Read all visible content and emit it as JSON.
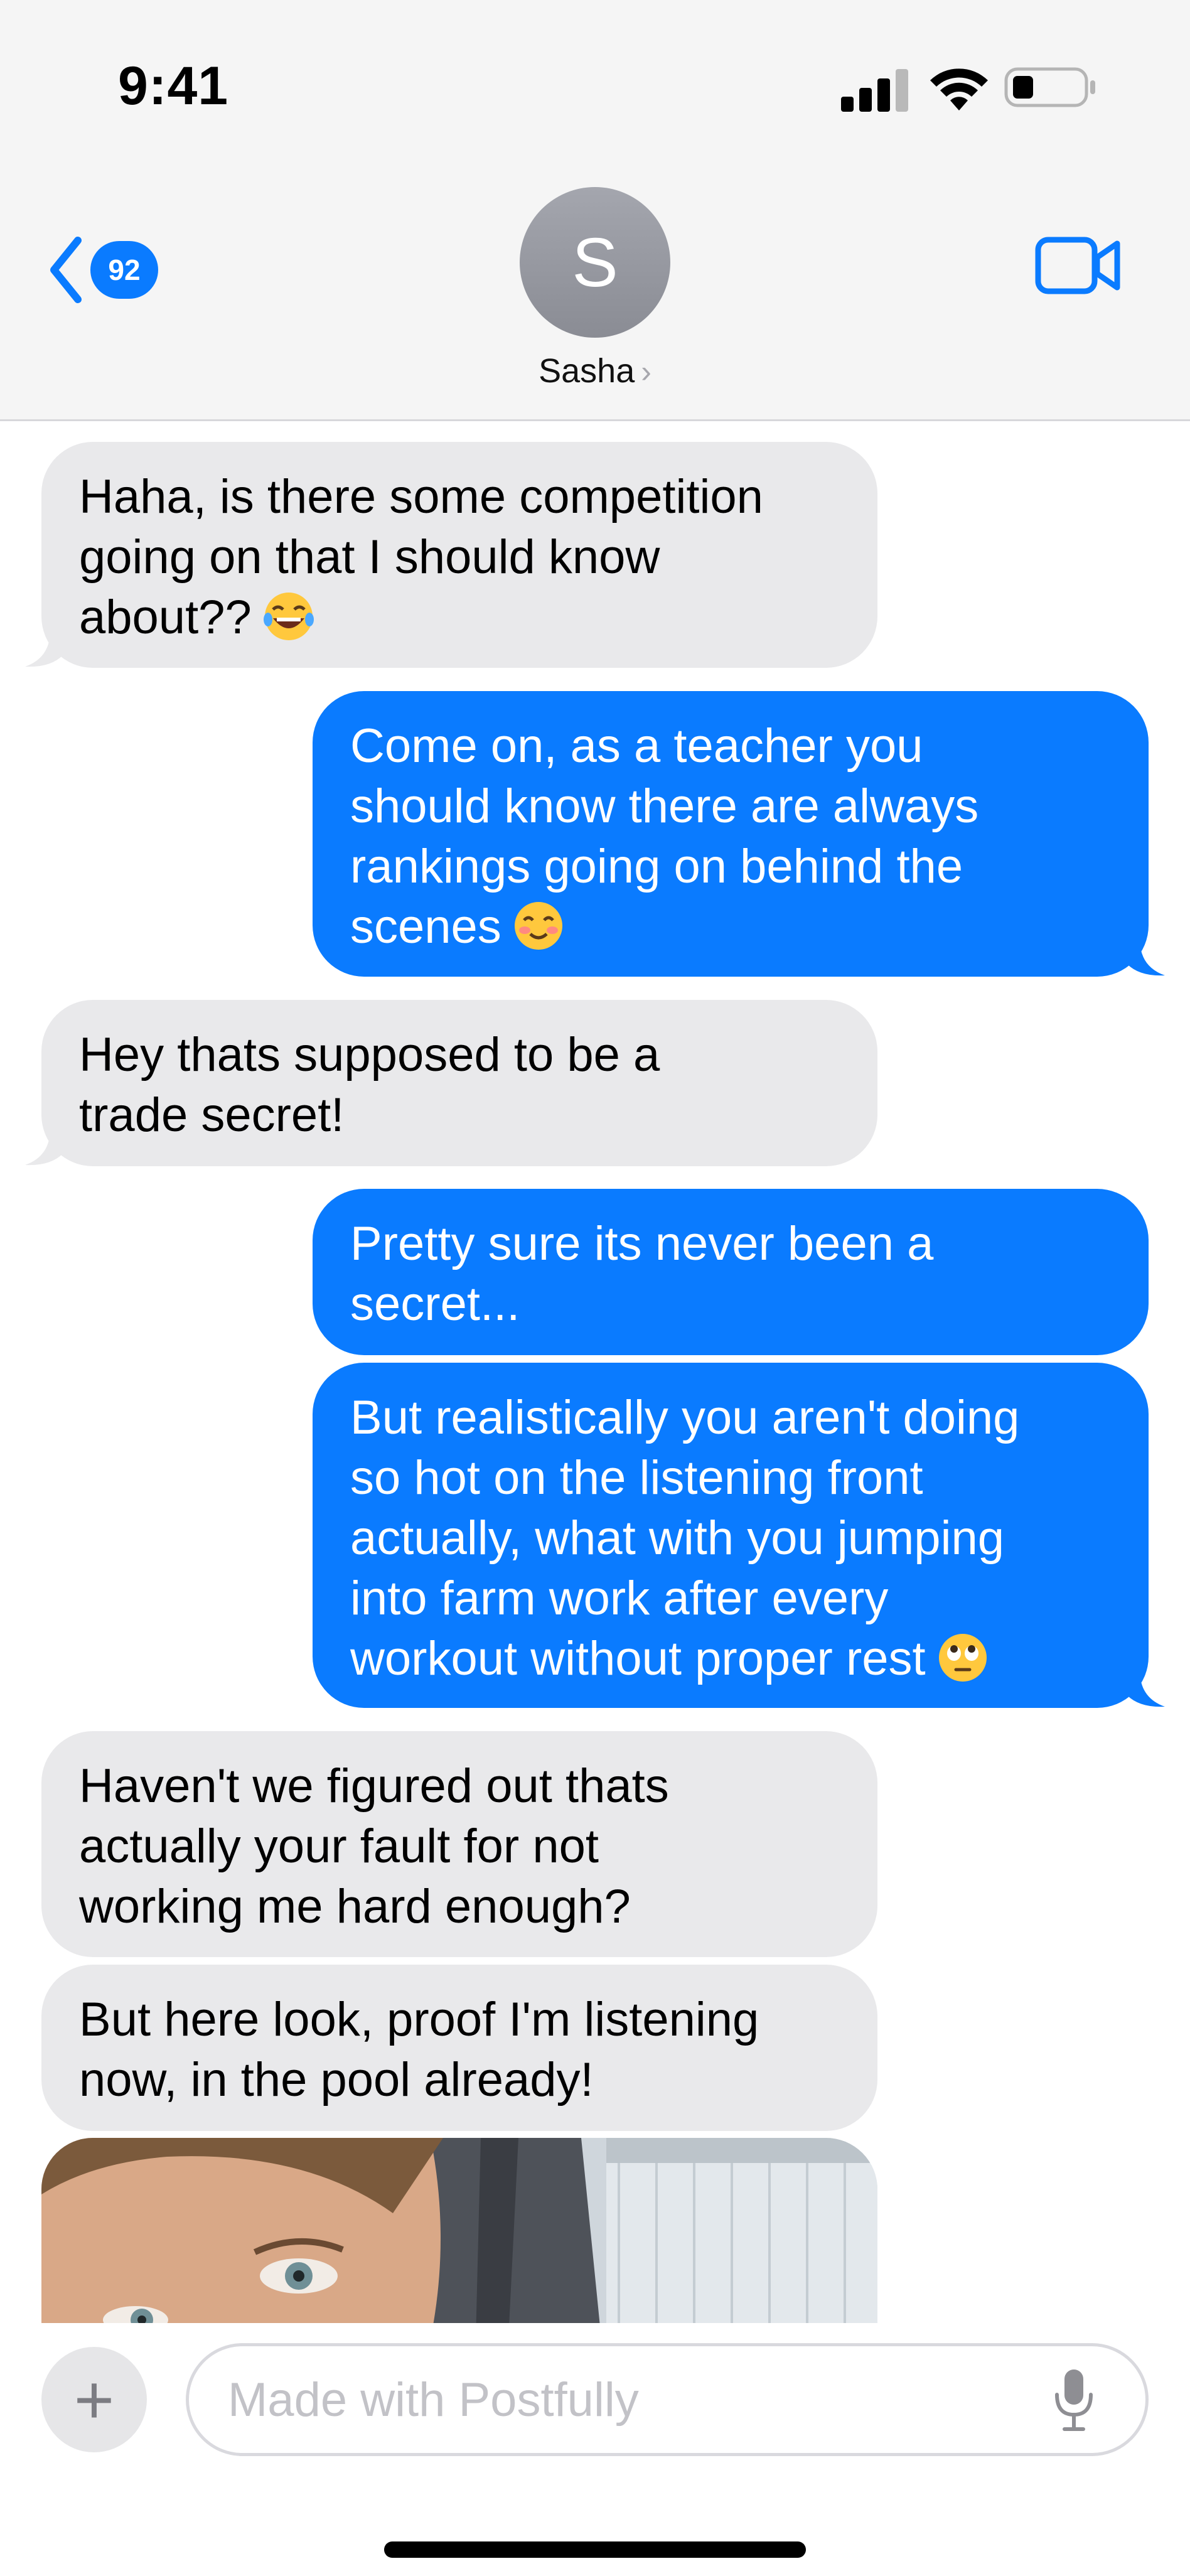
{
  "status_bar": {
    "time": "9:41",
    "icons": [
      "cellular-signal-icon",
      "wifi-icon",
      "battery-icon"
    ]
  },
  "header": {
    "back_badge_count": "92",
    "avatar_initial": "S",
    "contact_name": "Sasha",
    "contact_chevron": "›",
    "icons": [
      "chevron-left-icon",
      "video-camera-icon"
    ]
  },
  "messages": [
    {
      "side": "incoming",
      "lines": [
        "Haha, is there some competition",
        "going on that I should know",
        "about??"
      ],
      "emoji": "laughing-with-tears-emoji"
    },
    {
      "side": "outgoing",
      "lines": [
        "Come on, as a teacher you",
        "should know there are always",
        "rankings going on behind the",
        "scenes"
      ],
      "emoji": "smiling-blush-emoji"
    },
    {
      "side": "incoming",
      "lines": [
        "Hey thats supposed to be a",
        "trade secret!"
      ]
    },
    {
      "side": "outgoing",
      "lines": [
        "Pretty sure its never been a",
        "secret..."
      ]
    },
    {
      "side": "outgoing",
      "lines": [
        "But realistically you aren't doing",
        "so hot on the listening front",
        "actually, what with you jumping",
        "into farm work after every",
        "workout without proper rest"
      ],
      "emoji": "eye-roll-emoji"
    },
    {
      "side": "incoming",
      "lines": [
        "Haven't we figured out thats",
        "actually your fault for not",
        "working me hard enough?"
      ]
    },
    {
      "side": "incoming",
      "lines": [
        "But here look, proof I'm listening",
        "now, in the pool already!"
      ]
    },
    {
      "side": "incoming",
      "type": "photo",
      "description_icon": "selfie-photo"
    }
  ],
  "compose": {
    "plus_label": "+",
    "placeholder": "Made with Postfully",
    "icons": [
      "plus-icon",
      "microphone-icon"
    ]
  },
  "colors": {
    "outgoing_bubble": "#0a7bff",
    "incoming_bubble": "#e9e9eb",
    "accent": "#0a7bff"
  }
}
